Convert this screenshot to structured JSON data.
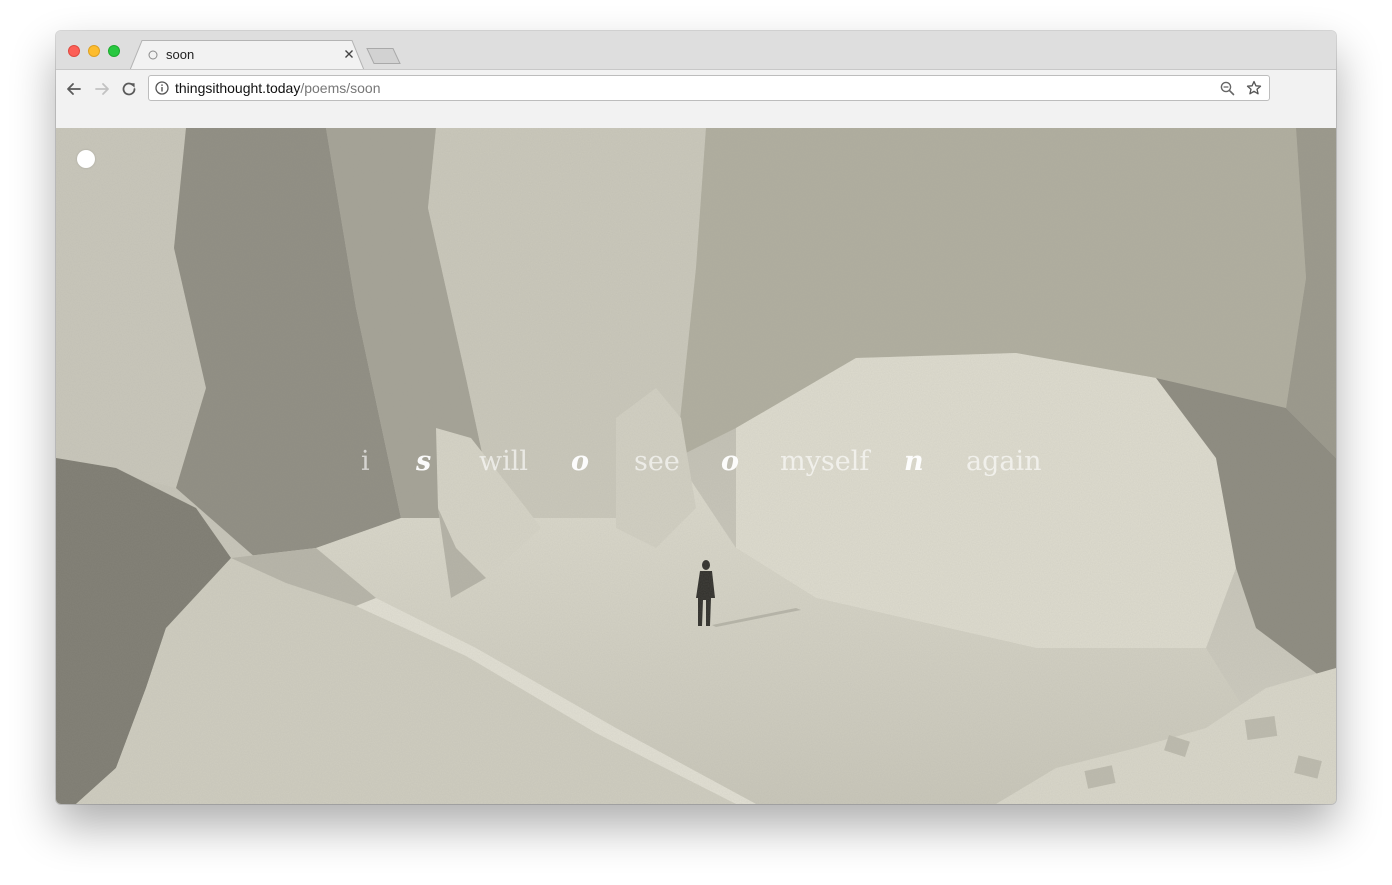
{
  "window": {
    "traffic_lights": [
      "close",
      "minimize",
      "zoom"
    ]
  },
  "tab": {
    "title": "soon",
    "favicon": "loading-circle-icon",
    "close_icon": "close-icon"
  },
  "toolbar": {
    "back_icon": "arrow-left-icon",
    "forward_icon": "arrow-right-icon",
    "reload_icon": "reload-icon",
    "url_host": "thingsithought.today",
    "url_path": "/poems/soon",
    "site_info_icon": "info-icon",
    "zoom_icon": "zoom-out-icon",
    "bookmark_icon": "star-icon"
  },
  "page": {
    "menu_icon": "white-dot-icon",
    "poem_words": [
      {
        "text": "i",
        "highlight": false
      },
      {
        "text": "s",
        "highlight": true
      },
      {
        "text": "will",
        "highlight": false
      },
      {
        "text": "o",
        "highlight": true
      },
      {
        "text": "see",
        "highlight": false
      },
      {
        "text": "o",
        "highlight": true
      },
      {
        "text": "myself",
        "highlight": false
      },
      {
        "text": "n",
        "highlight": true
      },
      {
        "text": "again",
        "highlight": false
      }
    ],
    "background": "sepia photograph of a lone figure standing among glacier ice blocks"
  },
  "colors": {
    "tabstrip": "#dedede",
    "toolbar": "#f2f2f2",
    "photo_tone": "#cfcdc0"
  }
}
